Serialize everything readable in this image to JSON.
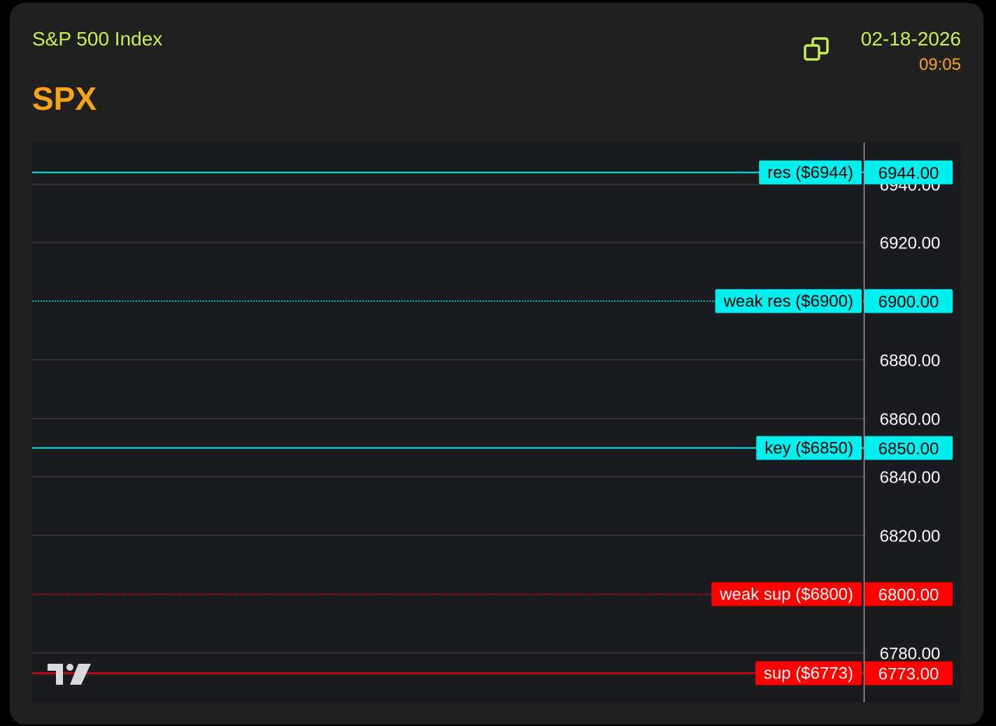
{
  "header": {
    "company": "S&P 500 Index",
    "ticker": "SPX",
    "date": "02-18-2026",
    "time": "09:05",
    "copy_icon": "copy-icon"
  },
  "colors": {
    "card_bg": "#202020",
    "chart_bg": "#1a1b1f",
    "grid": "#3a3b3f",
    "axis_text": "#ffffff",
    "resistance": "#00f0f0",
    "support": "#ff0000",
    "company_text": "#c6f04a",
    "ticker_text": "#f5a31a"
  },
  "chart_data": {
    "type": "line",
    "y_axis_side": "right",
    "ylim": [
      6763,
      6954
    ],
    "ticks": [
      6940,
      6920,
      6880,
      6860,
      6840,
      6820,
      6780
    ],
    "levels": [
      {
        "label": "res ($6944)",
        "value": 6944,
        "price_label": "6944.00",
        "style": "solid",
        "kind": "resistance"
      },
      {
        "label": "weak res ($6900)",
        "value": 6900,
        "price_label": "6900.00",
        "style": "dotted",
        "kind": "resistance"
      },
      {
        "label": "key ($6850)",
        "value": 6850,
        "price_label": "6850.00",
        "style": "solid",
        "kind": "resistance"
      },
      {
        "label": "weak sup ($6800)",
        "value": 6800,
        "price_label": "6800.00",
        "style": "dotted",
        "kind": "support"
      },
      {
        "label": "sup ($6773)",
        "value": 6773,
        "price_label": "6773.00",
        "style": "solid",
        "kind": "support"
      }
    ],
    "logo": "tradingview-logo"
  }
}
